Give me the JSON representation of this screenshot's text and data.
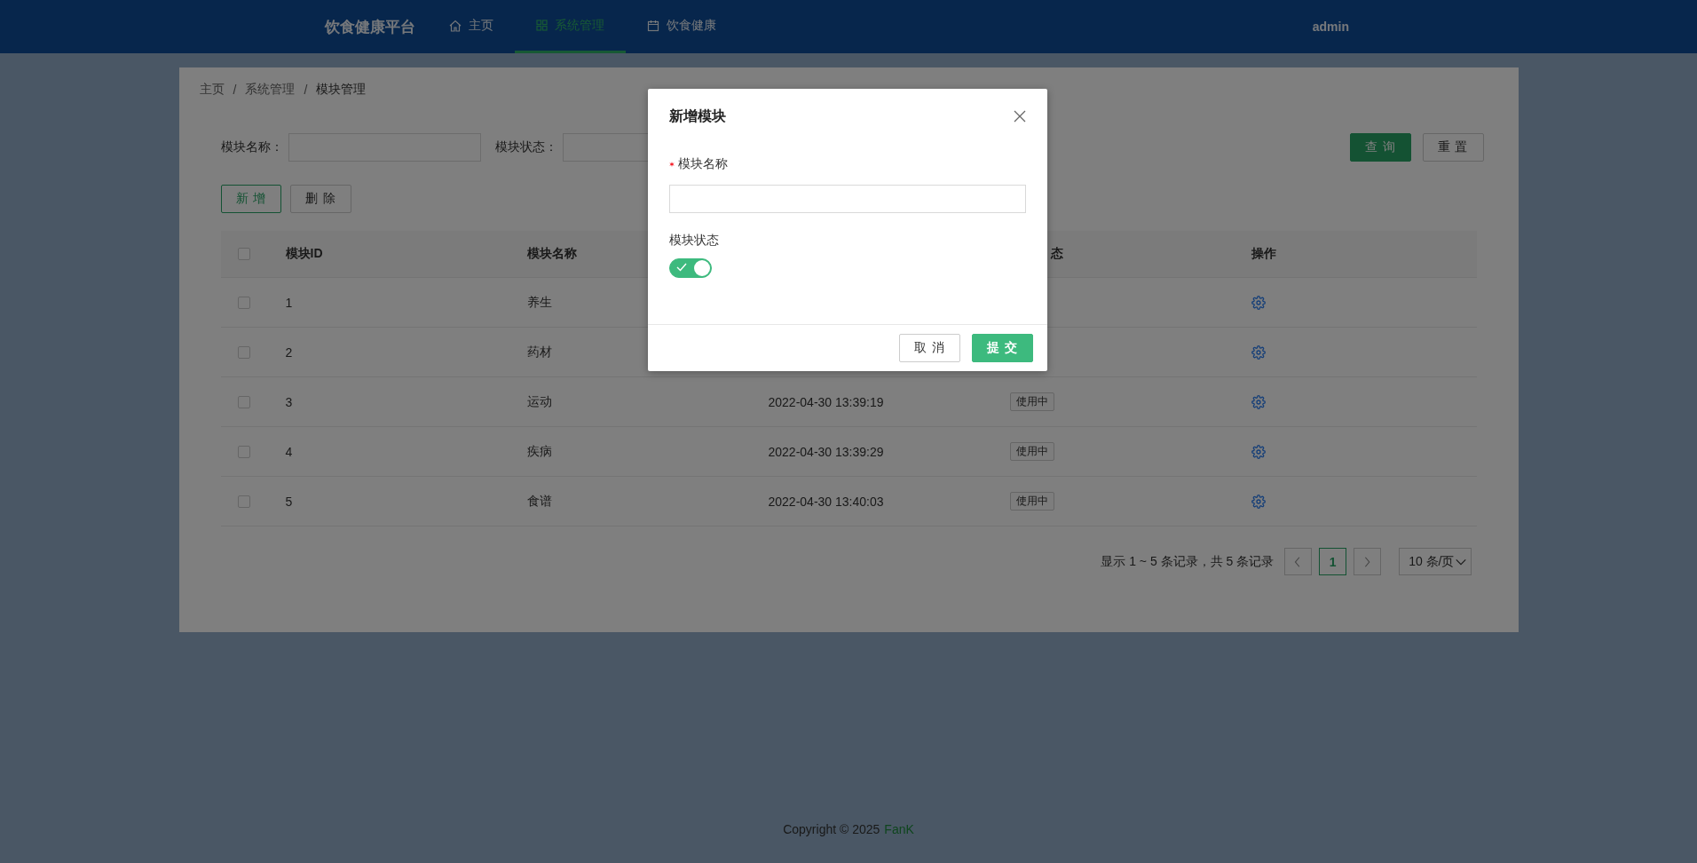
{
  "header": {
    "brand": "饮食健康平台",
    "nav": [
      {
        "label": "主页",
        "kind": "home",
        "selected": false
      },
      {
        "label": "系统管理",
        "kind": "grid",
        "selected": true
      },
      {
        "label": "饮食健康",
        "kind": "calendar",
        "selected": false
      }
    ],
    "user": "admin"
  },
  "breadcrumb": [
    {
      "label": "主页",
      "current": false
    },
    {
      "separator": "/",
      "label": "系统管理",
      "current": false
    },
    {
      "separator": "/",
      "label": "模块管理",
      "current": true
    }
  ],
  "filters": [
    {
      "label": "模块名称："
    },
    {
      "label": "模块状态："
    }
  ],
  "search_buttons": [
    {
      "label": "查 询",
      "kind": "primary"
    },
    {
      "label": "重 置",
      "kind": "default"
    }
  ],
  "toolbar": [
    {
      "label": "新 增",
      "kind": "outline"
    },
    {
      "label": "删 除",
      "kind": "default"
    }
  ],
  "table": {
    "select_all": {
      "checked": false
    },
    "columns": {
      "id": "模块ID",
      "name": "模块名称",
      "status": "态",
      "actions": "操作"
    },
    "rows": [
      {
        "checked": false,
        "id": "1",
        "name": "养生"
      },
      {
        "checked": false,
        "id": "2",
        "name": "药材"
      },
      {
        "checked": false,
        "id": "3",
        "name": "运动",
        "created": "2022-04-30 13:39:19",
        "status": "使用中"
      },
      {
        "checked": false,
        "id": "4",
        "name": "疾病",
        "created": "2022-04-30 13:39:29",
        "status": "使用中"
      },
      {
        "checked": false,
        "id": "5",
        "name": "食谱",
        "created": "2022-04-30 13:40:03",
        "status": "使用中"
      }
    ]
  },
  "pagination": {
    "summary": "显示 1 ~ 5 条记录，共 5 条记录",
    "pages": [
      {
        "label": "1",
        "selected": true
      }
    ],
    "page_size": "10 条/页"
  },
  "footer": {
    "text": "Copyright © 2025",
    "author": "FanK"
  },
  "modal": {
    "title": "新增模块",
    "fields": [
      {
        "kind": "text",
        "label": "模块名称",
        "required": true
      },
      {
        "kind": "switch",
        "label": "模块状态",
        "on": true
      }
    ],
    "buttons": [
      {
        "label": "取 消",
        "kind": "default"
      },
      {
        "label": "提 交",
        "kind": "primary"
      }
    ]
  }
}
